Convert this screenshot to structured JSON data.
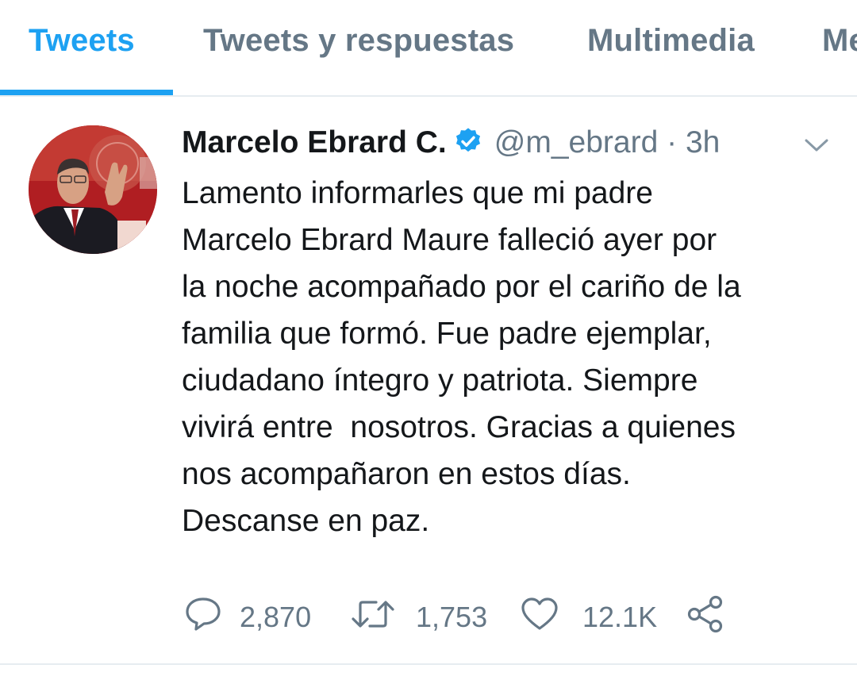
{
  "tabs": [
    {
      "label": "Tweets",
      "active": true
    },
    {
      "label": "Tweets y respuestas",
      "active": false
    },
    {
      "label": "Multimedia",
      "active": false
    },
    {
      "label": "Me Gusta",
      "active": false
    }
  ],
  "tweet": {
    "author_name": "Marcelo Ebrard C.",
    "verified": true,
    "handle": "@m_ebrard",
    "separator": "·",
    "time": "3h",
    "text": "Lamento informarles que mi padre\nMarcelo Ebrard Maure falleció ayer por\nla noche acompañado por el cariño de la\nfamilia que formó. Fue padre ejemplar,\nciudadano íntegro y patriota. Siempre\nvivirá entre  nosotros. Gracias a quienes\nnos acompañaron en estos días.\nDescanse en paz.",
    "replies": "2,870",
    "retweets": "1,753",
    "likes": "12.1K",
    "icons": {
      "reply": "reply-icon",
      "retweet": "retweet-icon",
      "like": "heart-icon",
      "share": "share-icon",
      "menu": "chevron-down-icon",
      "verified": "verified-badge-icon"
    }
  },
  "colors": {
    "accent": "#1da1f2",
    "text_primary": "#14171a",
    "text_secondary": "#657786",
    "divider": "#e6ecf0"
  }
}
